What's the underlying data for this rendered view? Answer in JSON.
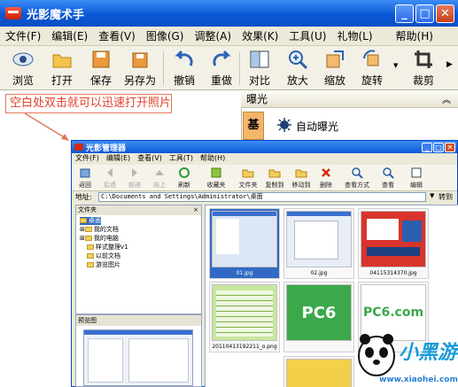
{
  "window": {
    "title": "光影魔术手"
  },
  "menubar": [
    "文件(F)",
    "编辑(E)",
    "查看(V)",
    "图像(G)",
    "调整(A)",
    "效果(K)",
    "工具(U)",
    "礼物(L)",
    "帮助(H)"
  ],
  "toolbar": [
    {
      "label": "浏览",
      "icon": "eye-icon"
    },
    {
      "label": "打开",
      "icon": "folder-open-icon"
    },
    {
      "label": "保存",
      "icon": "save-icon"
    },
    {
      "label": "另存为",
      "icon": "save-as-icon"
    },
    {
      "label": "撤销",
      "icon": "undo-icon"
    },
    {
      "label": "重做",
      "icon": "redo-icon"
    },
    {
      "label": "对比",
      "icon": "compare-icon"
    },
    {
      "label": "放大",
      "icon": "zoom-in-icon"
    },
    {
      "label": "缩放",
      "icon": "resize-icon"
    },
    {
      "label": "旋转",
      "icon": "rotate-icon"
    },
    {
      "label": "裁剪",
      "icon": "crop-icon"
    }
  ],
  "callout": "空白处双击就可以迅速打开照片",
  "right_panel": {
    "header": "曝光",
    "tab": "基本",
    "item": "自动曝光"
  },
  "manager": {
    "title": "光影管理器",
    "menu": [
      "文件(F)",
      "编辑(E)",
      "查看(V)",
      "工具(T)",
      "帮助(H)"
    ],
    "tools": [
      "返回",
      "后退",
      "前进",
      "向上",
      "刷新",
      "收藏夹",
      "文件夹",
      "复制到",
      "移动到",
      "删除",
      "查看方式",
      "查看",
      "编辑"
    ],
    "address_label": "地址:",
    "address": "C:\\Documents and Settings\\Administrator\\桌面",
    "go": "转到",
    "folder_header": "文件夹",
    "tree": [
      "桌面",
      "我的文档",
      "我的电脑",
      "样式整理v1",
      "以前文档",
      "游览图片"
    ],
    "preview_header": "预览图",
    "thumbs": [
      "01.jpg",
      "02.jpg",
      "04115314370.jpg",
      "20110413192211_o.png",
      "",
      ""
    ],
    "thumb_logos": [
      "PC6",
      "PC6.com"
    ]
  },
  "watermark": {
    "brand": "小黑游戏",
    "url": "www.xiaohei.com"
  },
  "colors": {
    "titlebar": "#0a57d6",
    "callout_text": "#e0402c",
    "jiben_tab": "#f4b66a"
  }
}
